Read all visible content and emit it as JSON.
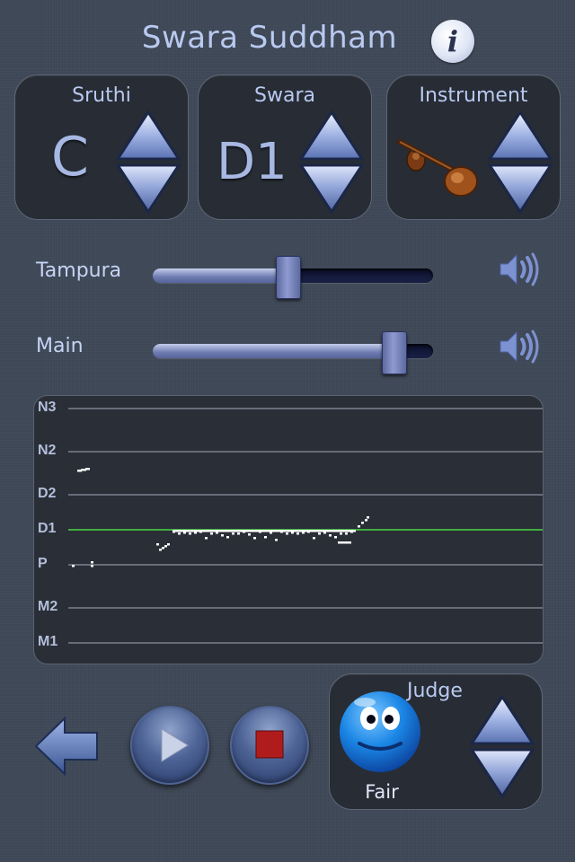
{
  "header": {
    "title": "Swara Suddham",
    "info_icon": "info-icon"
  },
  "selectors": {
    "sruthi": {
      "label": "Sruthi",
      "value": "C"
    },
    "swara": {
      "label": "Swara",
      "value": "D1"
    },
    "instrument": {
      "label": "Instrument",
      "icon": "veena-icon"
    }
  },
  "sliders": {
    "tampura": {
      "label": "Tampura",
      "level_percent": 48
    },
    "main": {
      "label": "Main",
      "level_percent": 86
    }
  },
  "pitch_graph": {
    "ticks": [
      "N3",
      "N2",
      "D2",
      "D1",
      "P",
      "M2",
      "M1"
    ],
    "target": "D1",
    "target_color": "#3fae3f"
  },
  "controls": {
    "back_icon": "back-arrow-icon",
    "play_icon": "play-icon",
    "stop_icon": "stop-icon"
  },
  "judge": {
    "label": "Judge",
    "verdict": "Fair",
    "face_icon": "smiley-face-icon"
  },
  "colors": {
    "accent": "#b9c9f0",
    "panel": "#272c35",
    "background": "#3e4756"
  }
}
